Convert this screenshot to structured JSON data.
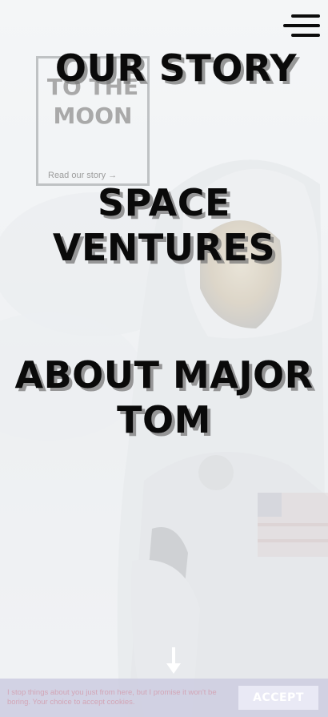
{
  "card": {
    "title": "TO THE MOON",
    "link_label": "Read our story →"
  },
  "menu": {
    "items": [
      {
        "label": "OUR STORY"
      },
      {
        "label": "SPACE VENTURES"
      },
      {
        "label": "ABOUT MAJOR TOM"
      }
    ]
  },
  "cookie": {
    "text": "I stop things about you just from here, but I promise it won't be boring. Your choice to accept cookies.",
    "accept_label": "ACCEPT"
  },
  "icons": {
    "menu": "hamburger-icon",
    "scroll": "down-arrow-icon"
  },
  "colors": {
    "menu_text": "#0a0a0a",
    "cookie_bar": "#cdcde1",
    "accept_button": "#e9e9f5"
  }
}
